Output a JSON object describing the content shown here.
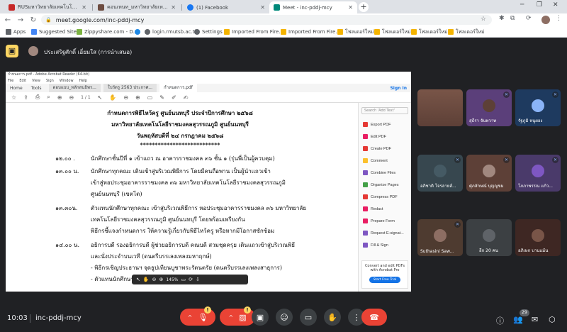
{
  "browser": {
    "tabs": [
      {
        "title": "RUSมหาวิทยาลัยเทคโนโลยีราชมงคลสุวรรณภูมิ",
        "favicon_color": "#c62828"
      },
      {
        "title": "คอนเทนท_มหาวิทยาลัยเทคโนโลยีราชมงคลสุวรรณภูมิ",
        "favicon_color": "#6d4c41"
      },
      {
        "title": "(1) Facebook",
        "favicon_color": "#1877f2"
      },
      {
        "title": "Meet - inc-pddj-mcy",
        "favicon_color": "#00897b"
      }
    ],
    "url": "meet.google.com/inc-pddj-mcy",
    "bookmarks": [
      {
        "label": "Apps",
        "icon": "apps-grid-icon"
      },
      {
        "label": "Suggested Sites",
        "icon": "suggested-sites-icon"
      },
      {
        "label": "Zippyshare.com - D...",
        "icon": "zippyshare-icon"
      },
      {
        "label": "",
        "icon": "ie-icon"
      },
      {
        "label": "login.rmutsb.ac.th",
        "icon": "globe-icon"
      },
      {
        "label": "Settings",
        "icon": "gear-icon"
      },
      {
        "label": "Imported From Fire...",
        "icon": "folder-icon"
      },
      {
        "label": "Imported From Fire...",
        "icon": "folder-icon"
      },
      {
        "label": "โฟลเดอร์ใหม่",
        "icon": "folder-icon"
      },
      {
        "label": "โฟลเดอร์ใหม่",
        "icon": "folder-icon"
      },
      {
        "label": "โฟลเดอร์ใหม่",
        "icon": "folder-icon"
      },
      {
        "label": "โฟลเดอร์ใหม่",
        "icon": "folder-icon"
      }
    ]
  },
  "meet": {
    "presenter": "ประเสริฐศักดิ์ เอี่ยมใส (การนำเสนอ)",
    "clock": "10:03",
    "meeting_code": "inc-pddj-mcy",
    "participant_count": "29",
    "participants": [
      {
        "name": "",
        "color": "#6d4c41"
      },
      {
        "name": "",
        "color": "#4e342e"
      },
      {
        "name": "",
        "color": "#1e3a5f"
      },
      {
        "name": "สุธีรา จันทวาท",
        "color": "#5d4037"
      },
      {
        "name": "รัฐภูมิ หนูผอง",
        "color": "#8ab4f8"
      },
      {
        "name": "อภิชาติ โจรลายส์...",
        "color": "#455a64"
      },
      {
        "name": "ศุภลักษณ์ บุญญขม",
        "color": "#6d4c41"
      },
      {
        "name": "โภภาพรรณ แก้ว...",
        "color": "#7e57c2"
      },
      {
        "name": "Suthasini Saw...",
        "color": "#8d6e63"
      },
      {
        "name": "อีก 20 คน",
        "color": "#5f6368"
      },
      {
        "name": "อภิเษก บานแม้น",
        "color": "#795548"
      }
    ]
  },
  "acrobat": {
    "window_title": "กำหนดการ.pdf - Adobe Acrobat Reader (64-bit)",
    "menu": [
      "File",
      "Edit",
      "View",
      "Sign",
      "Window",
      "Help"
    ],
    "tabs": [
      "Home",
      "Tools",
      "ตอบแบบ_หลักสนธิพร...",
      "ใบวัดรู 2563 ประกาศ...",
      "กำหนดการ.pdf"
    ],
    "signin": "Sign In",
    "page_indicator": "1 / 1",
    "zoom": "145%",
    "search_placeholder": "Search 'Add Text'",
    "tools": [
      "Export PDF",
      "Edit PDF",
      "Create PDF",
      "Comment",
      "Combine Files",
      "Organize Pages",
      "Compress PDF",
      "Redact",
      "Prepare Form",
      "Request E-signat...",
      "Fill & Sign"
    ],
    "promo_text": "Convert and edit PDFs with Acrobat Pro",
    "promo_cta": "Start Free Trial",
    "document": {
      "heading1": "กำหนดการพิธีไหว้ครู ศูนย์นนทบุรี ประจำปีการศึกษา ๒๕๖๘",
      "heading2": "มหาวิทยาลัยเทคโนโลยีราชมงคลสุวรรณภูมิ ศูนย์นนทบุรี",
      "heading3": "วันพฤหัสบดีที่ ๒๔ กรกฎาคม ๒๕๖๘",
      "stars": "***************************",
      "rows": [
        {
          "time": "๑๒.๐๐ .",
          "lines": [
            "นักศึกษาชั้นปีที่ ๑ เข้าแถว ณ อาคารราชมงคล ๓๖ ชั้น ๑ (รุ่นพี่เป็นผู้ควบคุม)"
          ]
        },
        {
          "time": "๑๓.๐๐ น.",
          "lines": [
            "นักศึกษาทุกคณะ เดินเข้าสู่บริเวณพิธีการ โดยมีคนถือพาน เป็นผู้นำแถวเข้า",
            "เข้าสู่หอประชุมอาคารราชมงคล ๓๖ มหาวิทยาลัยเทคโนโลยีราชมงคลสุวรรณภูมิ",
            "ศูนย์นนทบุรี (เขตโต)"
          ]
        },
        {
          "time": "๑๓.๓๐น.",
          "lines": [
            "ตัวแทนนักศึกษาทุกคณะ เข้าสู่บริเวณพิธีการ หอประชุมอาคารราชมงคล ๓๖  มหาวิทยาลัย",
            "เทคโนโลยีราชมงคลสุวรรณภูมิ ศูนย์นนทบุรี โดยพร้อมเพรียงกัน",
            "พิธีกรชี้แจงกำหนดการ ให้ความรู้เกี่ยวกับพิธีไหว้ครู หรือหากมีโอกาสซักซ้อม"
          ]
        },
        {
          "time": "๑๔.๐๐ น.",
          "lines": [
            "อธิการบดี รองอธิการบดี ผู้ช่วยอธิการบดี คณบดี สวมชุดครุย เดินแถวเข้าสู่บริเวณพิธี",
            "และนั่งประจำบนเวที (ดนตรีบรรเลงเพลงมหาฤกษ์)",
            "-  พิธีกรเชิญประธานฯ จุดธูปเทียนบูชาพระรัตนตรัย (ดนตรีบรรเลงเพลงสาธุการ)",
            "-  ตัวแทนนักศึกษา กล่าวคำนำพระรัตนตรัย"
          ]
        }
      ]
    }
  }
}
